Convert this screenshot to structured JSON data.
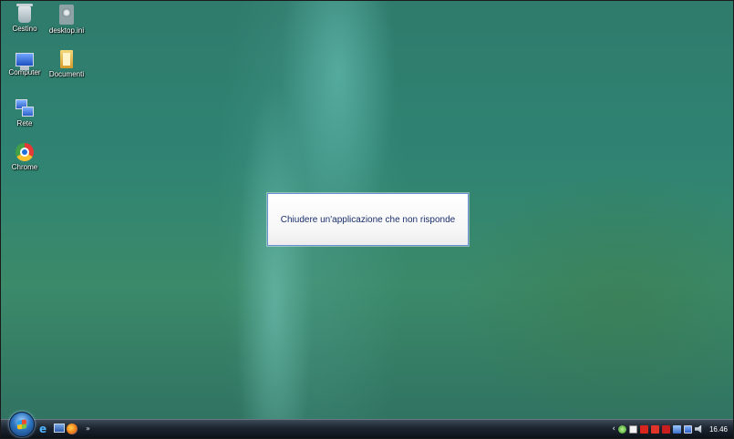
{
  "desktop": {
    "icons": [
      {
        "label": "Cestino",
        "icon": "recycle-bin-icon"
      },
      {
        "label": "desktop.ini",
        "icon": "settings-file-icon"
      },
      {
        "label": "Computer",
        "icon": "computer-icon"
      },
      {
        "label": "Documenti",
        "icon": "documents-folder-icon"
      },
      {
        "label": "Rete",
        "icon": "network-icon"
      },
      {
        "label": "Chrome",
        "icon": "chrome-icon"
      }
    ]
  },
  "popup": {
    "text": "Chiudere un'applicazione che non risponde"
  },
  "taskbar": {
    "quick_launch": [
      "internet-explorer-icon",
      "show-desktop-icon",
      "firefox-icon"
    ],
    "overflow_label": "»",
    "tray_arrow": "‹",
    "tray_icons": [
      "tray-green-icon",
      "tray-white-icon",
      "tray-red-icon",
      "tray-red2-icon",
      "tray-red3-icon",
      "network-tray-icon",
      "monitor-tray-icon",
      "volume-icon"
    ],
    "clock": "16.46"
  },
  "colors": {
    "wallpaper": "#2e7a66",
    "popup_text": "#1a2f6b",
    "popup_border": "#6b8fd6"
  }
}
